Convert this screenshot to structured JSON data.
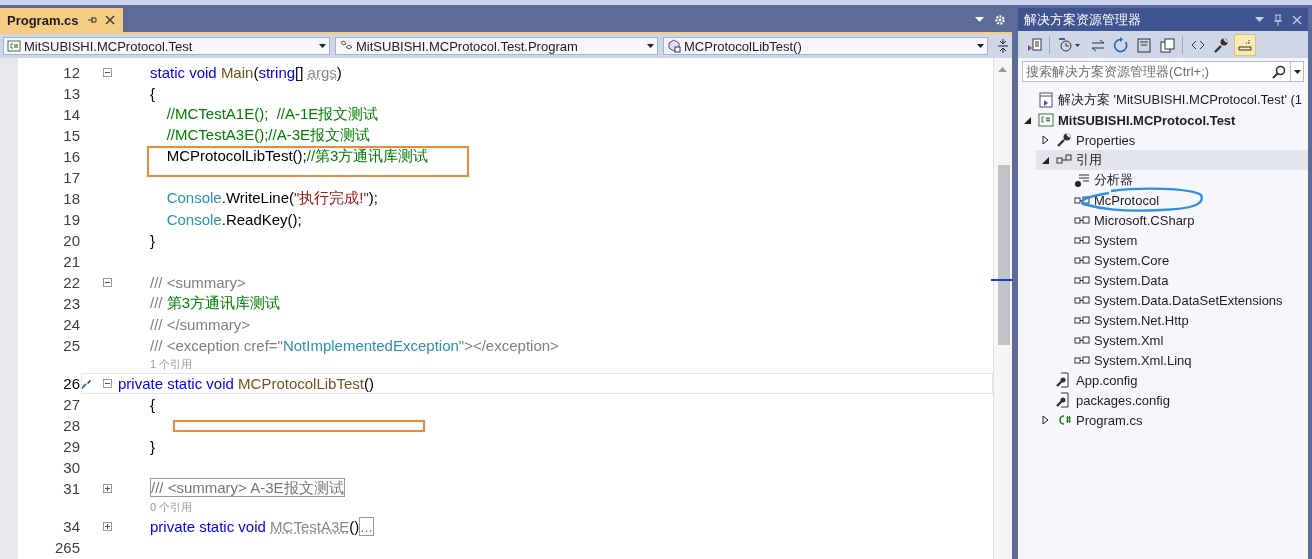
{
  "editor": {
    "tab": {
      "title": "Program.cs",
      "selected": true
    },
    "nav": [
      "MitSUBISHI.MCProtocol.Test",
      "MitSUBISHI.MCProtocol.Test.Program",
      "MCProtocolLibTest()"
    ],
    "lines": [
      {
        "kind": "code",
        "number": "12",
        "folded": false,
        "current": false,
        "tokens": [
          {
            "t": "static void ",
            "kind": "kw"
          },
          {
            "t": "Main",
            "kind": "method"
          },
          {
            "t": "(",
            "kind": "text"
          },
          {
            "t": "string",
            "kind": "kw"
          },
          {
            "t": "[] ",
            "kind": "text"
          },
          {
            "t": "args",
            "kind": "unused"
          },
          {
            "t": ")",
            "kind": "text"
          }
        ]
      },
      {
        "kind": "code",
        "number": "13",
        "current": false,
        "tokens": [
          {
            "t": "{",
            "kind": "text"
          }
        ]
      },
      {
        "kind": "code",
        "number": "14",
        "current": false,
        "tokens": [
          {
            "t": "    //MCTestA1E();  //A-1E报文测试",
            "kind": "comment"
          }
        ]
      },
      {
        "kind": "code",
        "number": "15",
        "current": false,
        "tokens": [
          {
            "t": "    //MCTestA3E();//A-3E报文测试",
            "kind": "comment"
          }
        ]
      },
      {
        "kind": "code",
        "number": "16",
        "current": false,
        "annotation": {
          "kind": "tall"
        },
        "tokens": [
          {
            "t": "    MCProtocolLibTest();",
            "kind": "text"
          },
          {
            "t": "//第3方通讯库测试",
            "kind": "comment"
          }
        ]
      },
      {
        "kind": "code",
        "number": "17",
        "current": false
      },
      {
        "kind": "code",
        "number": "18",
        "current": false,
        "tokens": [
          {
            "t": "    Console",
            "kind": "type"
          },
          {
            "t": ".WriteLine(",
            "kind": "text"
          },
          {
            "t": "\"执行完成!\"",
            "kind": "string"
          },
          {
            "t": ");",
            "kind": "text"
          }
        ]
      },
      {
        "kind": "code",
        "number": "19",
        "current": false,
        "tokens": [
          {
            "t": "    Console",
            "kind": "type"
          },
          {
            "t": ".ReadKey();",
            "kind": "text"
          }
        ]
      },
      {
        "kind": "code",
        "number": "20",
        "current": false,
        "tokens": [
          {
            "t": "}",
            "kind": "text"
          }
        ]
      },
      {
        "kind": "code",
        "number": "21",
        "current": false
      },
      {
        "kind": "code",
        "number": "22",
        "folded": false,
        "current": false,
        "tokens": [
          {
            "t": "/// <summary>",
            "kind": "doc"
          }
        ]
      },
      {
        "kind": "code",
        "number": "23",
        "current": false,
        "tokens": [
          {
            "t": "/// ",
            "kind": "doc"
          },
          {
            "t": "第3方通讯库测试",
            "kind": "comment"
          }
        ]
      },
      {
        "kind": "code",
        "number": "24",
        "current": false,
        "tokens": [
          {
            "t": "/// </summary>",
            "kind": "doc"
          }
        ]
      },
      {
        "kind": "code",
        "number": "25",
        "current": false,
        "tokens": [
          {
            "t": "/// <exception cref=\"",
            "kind": "doc"
          },
          {
            "t": "NotImplementedException",
            "kind": "type"
          },
          {
            "t": "\"></exception>",
            "kind": "doc"
          }
        ]
      },
      {
        "kind": "lens",
        "text": "1 个引用"
      },
      {
        "kind": "code",
        "number": "26",
        "folded": false,
        "current": true,
        "tokens": [
          {
            "t": "private static void ",
            "kind": "kw"
          },
          {
            "t": "MCProtocolLibTest",
            "kind": "method"
          },
          {
            "t": "()",
            "kind": "text"
          }
        ]
      },
      {
        "kind": "code",
        "number": "27",
        "current": false,
        "tokens": [
          {
            "t": "{",
            "kind": "text"
          }
        ]
      },
      {
        "kind": "code",
        "number": "28",
        "current": false,
        "annotation": {
          "kind": "thin"
        }
      },
      {
        "kind": "code",
        "number": "29",
        "current": false,
        "tokens": [
          {
            "t": "}",
            "kind": "text"
          }
        ]
      },
      {
        "kind": "code",
        "number": "30",
        "current": false
      },
      {
        "kind": "code",
        "number": "31",
        "folded": true,
        "current": false,
        "tokens": [
          {
            "t": "/// <summary> A-3E报文测试",
            "kind": "collapsed"
          }
        ]
      },
      {
        "kind": "lens",
        "text": "0 个引用"
      },
      {
        "kind": "code",
        "number": "34",
        "folded": true,
        "current": false,
        "tokens": [
          {
            "t": "private static void ",
            "kind": "kw"
          },
          {
            "t": "MCTestA3E",
            "kind": "unused"
          },
          {
            "t": "()",
            "kind": "text"
          },
          {
            "t": "...",
            "kind": "collapsed"
          }
        ]
      },
      {
        "kind": "code",
        "number": "265",
        "current": false
      }
    ]
  },
  "solution_explorer": {
    "title": "解决方案资源管理器",
    "toolbar": [
      {
        "kind": "switch",
        "pressed": false
      },
      {
        "kind": "history",
        "pressed": false
      },
      {
        "kind": "sync",
        "pressed": false
      },
      {
        "kind": "refresh",
        "pressed": false
      },
      {
        "kind": "collapse",
        "pressed": false
      },
      {
        "kind": "copies",
        "pressed": false
      },
      {
        "kind": "code",
        "pressed": false
      },
      {
        "kind": "properties",
        "pressed": false
      },
      {
        "kind": "preview",
        "pressed": true
      }
    ],
    "search": {
      "placeholder": "搜索解决方案资源管理器(Ctrl+;)"
    },
    "tree": [
      {
        "kind": "solution",
        "label": "解决方案 'MitSUBISHI.MCProtocol.Test' (1",
        "selected": false
      },
      {
        "kind": "project",
        "label": "MitSUBISHI.MCProtocol.Test",
        "selected": false,
        "expanded": true,
        "children": [
          {
            "kind": "wrench",
            "label": "Properties",
            "selected": false,
            "expanded": false
          },
          {
            "kind": "references",
            "label": "引用",
            "selected": true,
            "expanded": true,
            "children": [
              {
                "kind": "analyzer",
                "label": "分析器",
                "selected": false
              },
              {
                "kind": "assembly",
                "label": "McProtocol",
                "selected": false,
                "circled": true
              },
              {
                "kind": "assembly",
                "label": "Microsoft.CSharp",
                "selected": false
              },
              {
                "kind": "assembly",
                "label": "System",
                "selected": false
              },
              {
                "kind": "assembly",
                "label": "System.Core",
                "selected": false
              },
              {
                "kind": "assembly",
                "label": "System.Data",
                "selected": false
              },
              {
                "kind": "assembly",
                "label": "System.Data.DataSetExtensions",
                "selected": false
              },
              {
                "kind": "assembly",
                "label": "System.Net.Http",
                "selected": false
              },
              {
                "kind": "assembly",
                "label": "System.Xml",
                "selected": false
              },
              {
                "kind": "assembly",
                "label": "System.Xml.Linq",
                "selected": false
              }
            ]
          },
          {
            "kind": "config",
            "label": "App.config",
            "selected": false
          },
          {
            "kind": "config",
            "label": "packages.config",
            "selected": false
          },
          {
            "kind": "csharp",
            "label": "Program.cs",
            "selected": false,
            "expanded": false
          }
        ]
      }
    ]
  }
}
